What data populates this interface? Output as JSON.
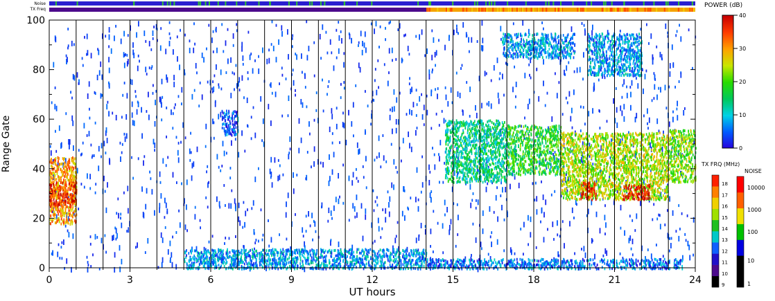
{
  "chart_data": {
    "type": "heatmap",
    "xlabel": "UT hours",
    "ylabel": "Range Gate",
    "xlim": [
      0,
      24
    ],
    "ylim": [
      0,
      100
    ],
    "x_ticks": [
      "0",
      "3",
      "6",
      "9",
      "12",
      "15",
      "18",
      "21",
      "24"
    ],
    "y_ticks": [
      "0",
      "20",
      "40",
      "60",
      "80",
      "100"
    ],
    "grid": "vertical lines at each hour",
    "top_bars": {
      "noise_label": "Noise",
      "txfreq_label": "TX Freq"
    },
    "power_scale": {
      "title": "POWER (dB)",
      "ticks": [
        "0",
        "10",
        "20",
        "30",
        "40"
      ],
      "range": [
        0,
        40
      ]
    },
    "txfreq_scale": {
      "title": "TX FRQ (MHz)",
      "ticks": [
        "9",
        "10",
        "11",
        "12",
        "13",
        "14",
        "15",
        "16",
        "17",
        "18"
      ]
    },
    "noise_scale": {
      "title": "NOISE",
      "ticks": [
        "1",
        "10",
        "100",
        "1000",
        "10000"
      ]
    },
    "echo_regions": [
      {
        "t0": 0.0,
        "t1": 1.0,
        "g0": 18,
        "g1": 45,
        "power": 30
      },
      {
        "t0": 0.0,
        "t1": 1.0,
        "g0": 25,
        "g1": 35,
        "power": 36
      },
      {
        "t0": 6.4,
        "t1": 7.0,
        "g0": 54,
        "g1": 64,
        "power": 5
      },
      {
        "t0": 14.7,
        "t1": 17.0,
        "g0": 35,
        "g1": 60,
        "power": 14
      },
      {
        "t0": 17.0,
        "t1": 19.0,
        "g0": 38,
        "g1": 58,
        "power": 18
      },
      {
        "t0": 16.8,
        "t1": 19.5,
        "g0": 85,
        "g1": 95,
        "power": 8
      },
      {
        "t0": 19.0,
        "t1": 21.0,
        "g0": 28,
        "g1": 55,
        "power": 24
      },
      {
        "t0": 19.7,
        "t1": 20.3,
        "g0": 28,
        "g1": 35,
        "power": 36
      },
      {
        "t0": 20.0,
        "t1": 22.0,
        "g0": 78,
        "g1": 95,
        "power": 8
      },
      {
        "t0": 21.0,
        "t1": 23.0,
        "g0": 28,
        "g1": 55,
        "power": 24
      },
      {
        "t0": 21.3,
        "t1": 22.3,
        "g0": 28,
        "g1": 34,
        "power": 38
      },
      {
        "t0": 23.0,
        "t1": 24.0,
        "g0": 35,
        "g1": 56,
        "power": 22
      },
      {
        "t0": 5.0,
        "t1": 14.0,
        "g0": 0,
        "g1": 8,
        "power": 8
      },
      {
        "t0": 14.0,
        "t1": 23.5,
        "g0": 0,
        "g1": 4,
        "power": 6
      }
    ]
  }
}
